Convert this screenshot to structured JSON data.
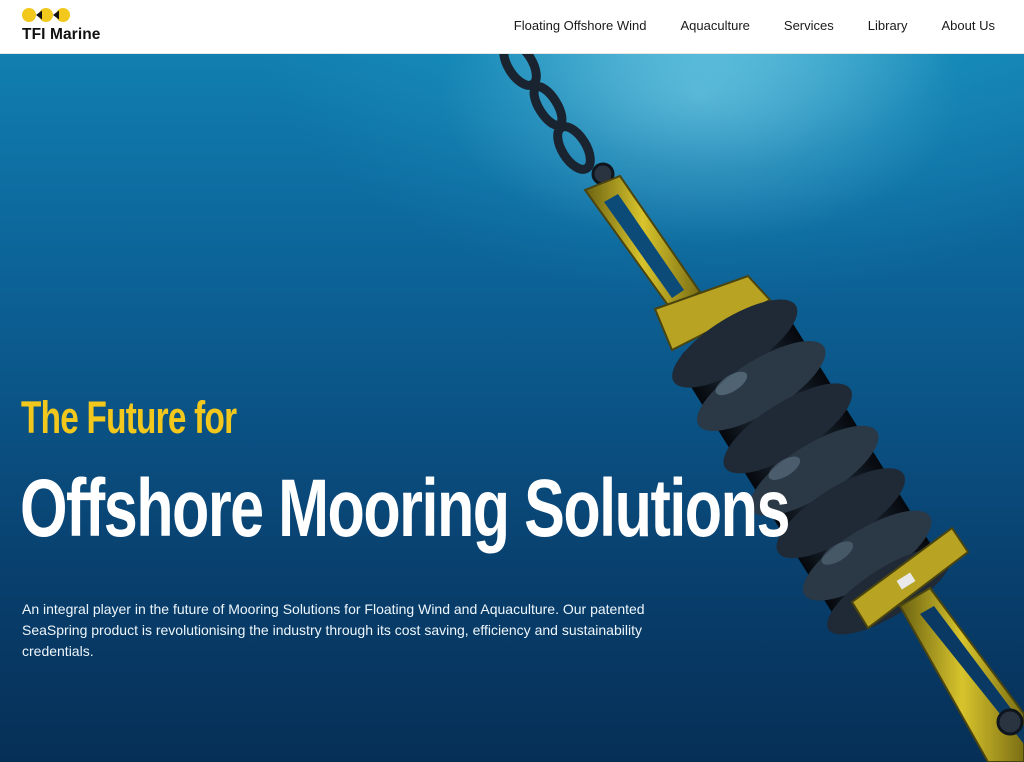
{
  "brand": {
    "name": "TFI Marine",
    "colors": {
      "yellow": "#f2c81c",
      "ink": "#111111",
      "ocean": "#0b5588"
    }
  },
  "nav": {
    "items": [
      {
        "label": "Floating Offshore Wind"
      },
      {
        "label": "Aquaculture"
      },
      {
        "label": "Services"
      },
      {
        "label": "Library"
      },
      {
        "label": "About Us"
      }
    ]
  },
  "hero": {
    "eyebrow": "The Future for",
    "title": "Offshore Mooring Solutions",
    "description": "An integral player in the future of Mooring Solutions for Floating Wind and Aquaculture. Our patented SeaSpring product is revolutionising the industry through its cost saving, efficiency and sustainability credentials.",
    "image_subject": "seaspring-mooring-product-underwater"
  }
}
